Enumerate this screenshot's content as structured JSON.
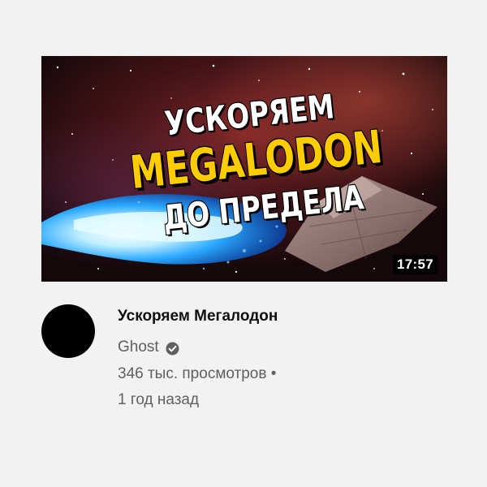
{
  "video": {
    "thumbnail": {
      "line1": "УСКОРЯЕМ",
      "line2": "MEGALODON",
      "line3": "ДО ПРЕДЕЛА",
      "accent_color": "#ffcc00",
      "text_color": "#ffffff"
    },
    "duration": "17:57",
    "title": "Ускоряем Мегалодон",
    "channel": {
      "name": "Ghost",
      "verified_icon": "verified-check-icon"
    },
    "views": "346 тыс. просмотров •",
    "age": "1 год назад"
  }
}
